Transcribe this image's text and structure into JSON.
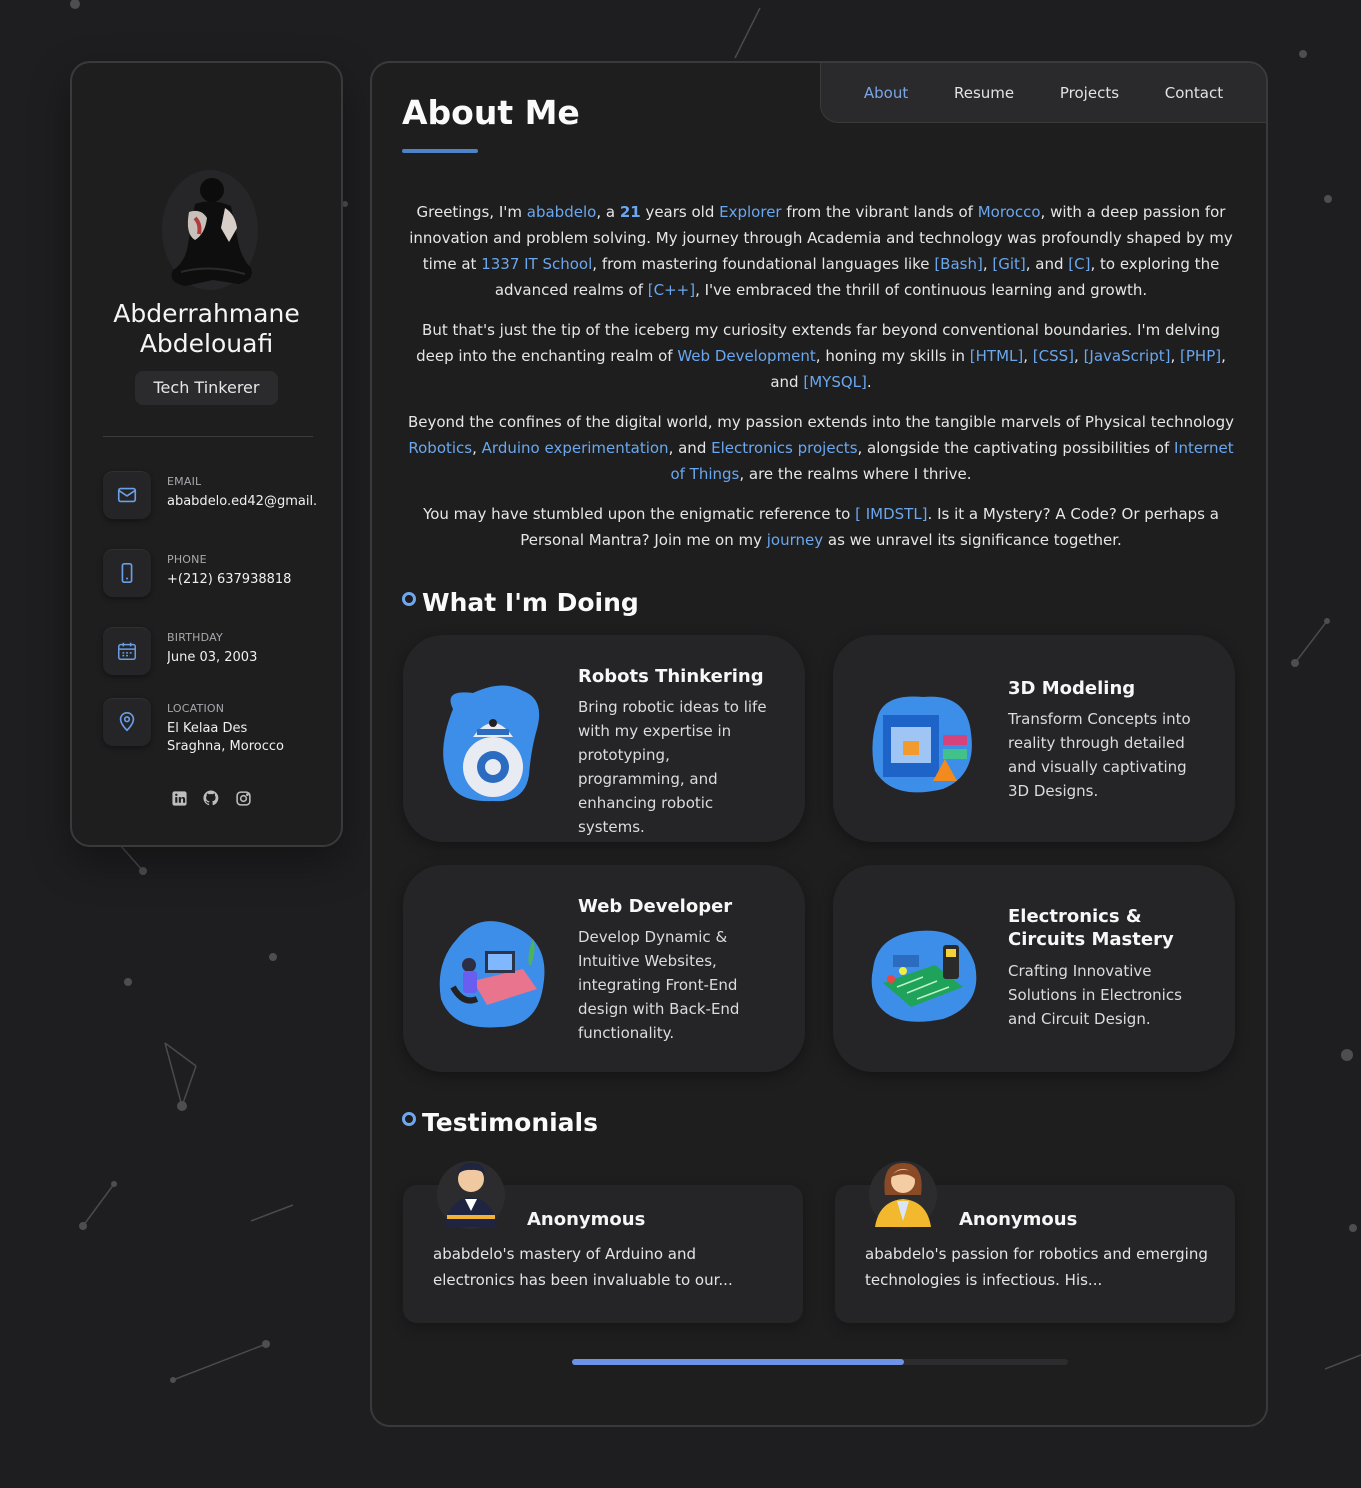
{
  "profile": {
    "name": "Abderrahmane Abdelouafi",
    "title": "Tech Tinkerer"
  },
  "contacts": [
    {
      "label": "EMAIL",
      "value": "ababdelo.ed42@gmail.com",
      "icon": "mail-icon"
    },
    {
      "label": "PHONE",
      "value": "+(212) 637938818",
      "icon": "phone-icon"
    },
    {
      "label": "BIRTHDAY",
      "value": "June 03, 2003",
      "icon": "calendar-icon"
    },
    {
      "label": "LOCATION",
      "value": "El Kelaa Des Sraghna, Morocco",
      "icon": "location-icon"
    }
  ],
  "socials": [
    "linkedin-icon",
    "github-icon",
    "instagram-icon"
  ],
  "nav": {
    "items": [
      "About",
      "Resume",
      "Projects",
      "Contact"
    ],
    "active": "About"
  },
  "about": {
    "heading": "About Me",
    "p1": {
      "t1": "Greetings, I'm ",
      "h1": "ababdelo",
      "t2": ", a ",
      "h2": "21",
      "t3": " years old ",
      "h3": "Explorer",
      "t4": " from the vibrant lands of ",
      "h4": "Morocco",
      "t5": ", with a deep passion for innovation and problem solving. My journey through Academia and technology was profoundly shaped by my time at ",
      "h5": "1337 IT School",
      "t6": ", from mastering foundational languages like ",
      "h6": "[Bash]",
      "t7": ", ",
      "h7": "[Git]",
      "t8": ", and ",
      "h8": "[C]",
      "t9": ", to exploring the advanced realms of ",
      "h9": "[C++]",
      "t10": ", I've embraced the thrill of continuous learning and growth."
    },
    "p2": {
      "t1": "But that's just the tip of the iceberg my curiosity extends far beyond conventional boundaries. I'm delving deep into the enchanting realm of ",
      "h1": "Web Development",
      "t2": ", honing my skills in ",
      "h2": "[HTML]",
      "t3": ", ",
      "h3": "[CSS]",
      "t4": ", ",
      "h4": "[JavaScript]",
      "t5": ", ",
      "h5": "[PHP]",
      "t6": ", and ",
      "h6": "[MYSQL]",
      "t7": "."
    },
    "p3": {
      "t1": "Beyond the confines of the digital world, my passion extends into the tangible marvels of Physical technology ",
      "h1": "Robotics",
      "t2": ", ",
      "h2": "Arduino experimentation",
      "t3": ", and ",
      "h3": "Electronics projects",
      "t4": ", alongside the captivating possibilities of ",
      "h4": "Internet of Things",
      "t5": ", are the realms where I thrive."
    },
    "p4": {
      "t1": "You may have stumbled upon the enigmatic reference to ",
      "h1": "[ IMDSTL]",
      "t2": ". Is it a Mystery? A Code? Or perhaps a Personal Mantra? Join me on my ",
      "h2": "journey",
      "t3": " as we unravel its significance together."
    }
  },
  "services": {
    "heading": "What I'm Doing",
    "items": [
      {
        "title": "Robots Thinkering",
        "desc": "Bring robotic ideas to life with my expertise in prototyping, programming, and enhancing robotic systems."
      },
      {
        "title": "3D Modeling",
        "desc": "Transform Concepts into reality through detailed and visually captivating 3D Designs."
      },
      {
        "title": "Web Developer",
        "desc": "Develop Dynamic & Intuitive Websites, integrating Front-End design with Back-End functionality."
      },
      {
        "title": "Electronics & Circuits Mastery",
        "desc": "Crafting Innovative Solutions in Electronics and Circuit Design."
      }
    ]
  },
  "testimonials": {
    "heading": "Testimonials",
    "items": [
      {
        "name": "Anonymous",
        "text": "ababdelo's mastery of Arduino and electronics has been invaluable to our..."
      },
      {
        "name": "Anonymous",
        "text": "ababdelo's passion for robotics and emerging technologies is infectious. His..."
      }
    ],
    "scroll_progress": 0.67
  },
  "colors": {
    "accent": "#6aa7ee",
    "background": "#1e1e20",
    "card": "#252527"
  }
}
